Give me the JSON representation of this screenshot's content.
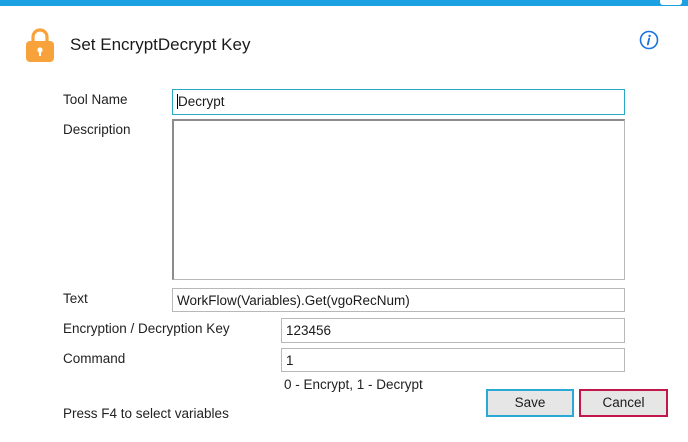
{
  "dialog": {
    "title": "Set EncryptDecrypt Key",
    "icon": "lock-icon",
    "accent_color": "#1ba1e2",
    "info_icon": "info-icon"
  },
  "form": {
    "tool_name": {
      "label": "Tool Name",
      "value": "Decrypt"
    },
    "description": {
      "label": "Description",
      "value": ""
    },
    "text": {
      "label": "Text",
      "value": "WorkFlow(Variables).Get(vgoRecNum)"
    },
    "key": {
      "label": "Encryption / Decryption Key",
      "value": "123456"
    },
    "command": {
      "label": "Command",
      "value": "1",
      "hint": "0 - Encrypt, 1 - Decrypt"
    }
  },
  "footer": {
    "note": "Press F4 to select variables",
    "save_label": "Save",
    "cancel_label": "Cancel"
  }
}
